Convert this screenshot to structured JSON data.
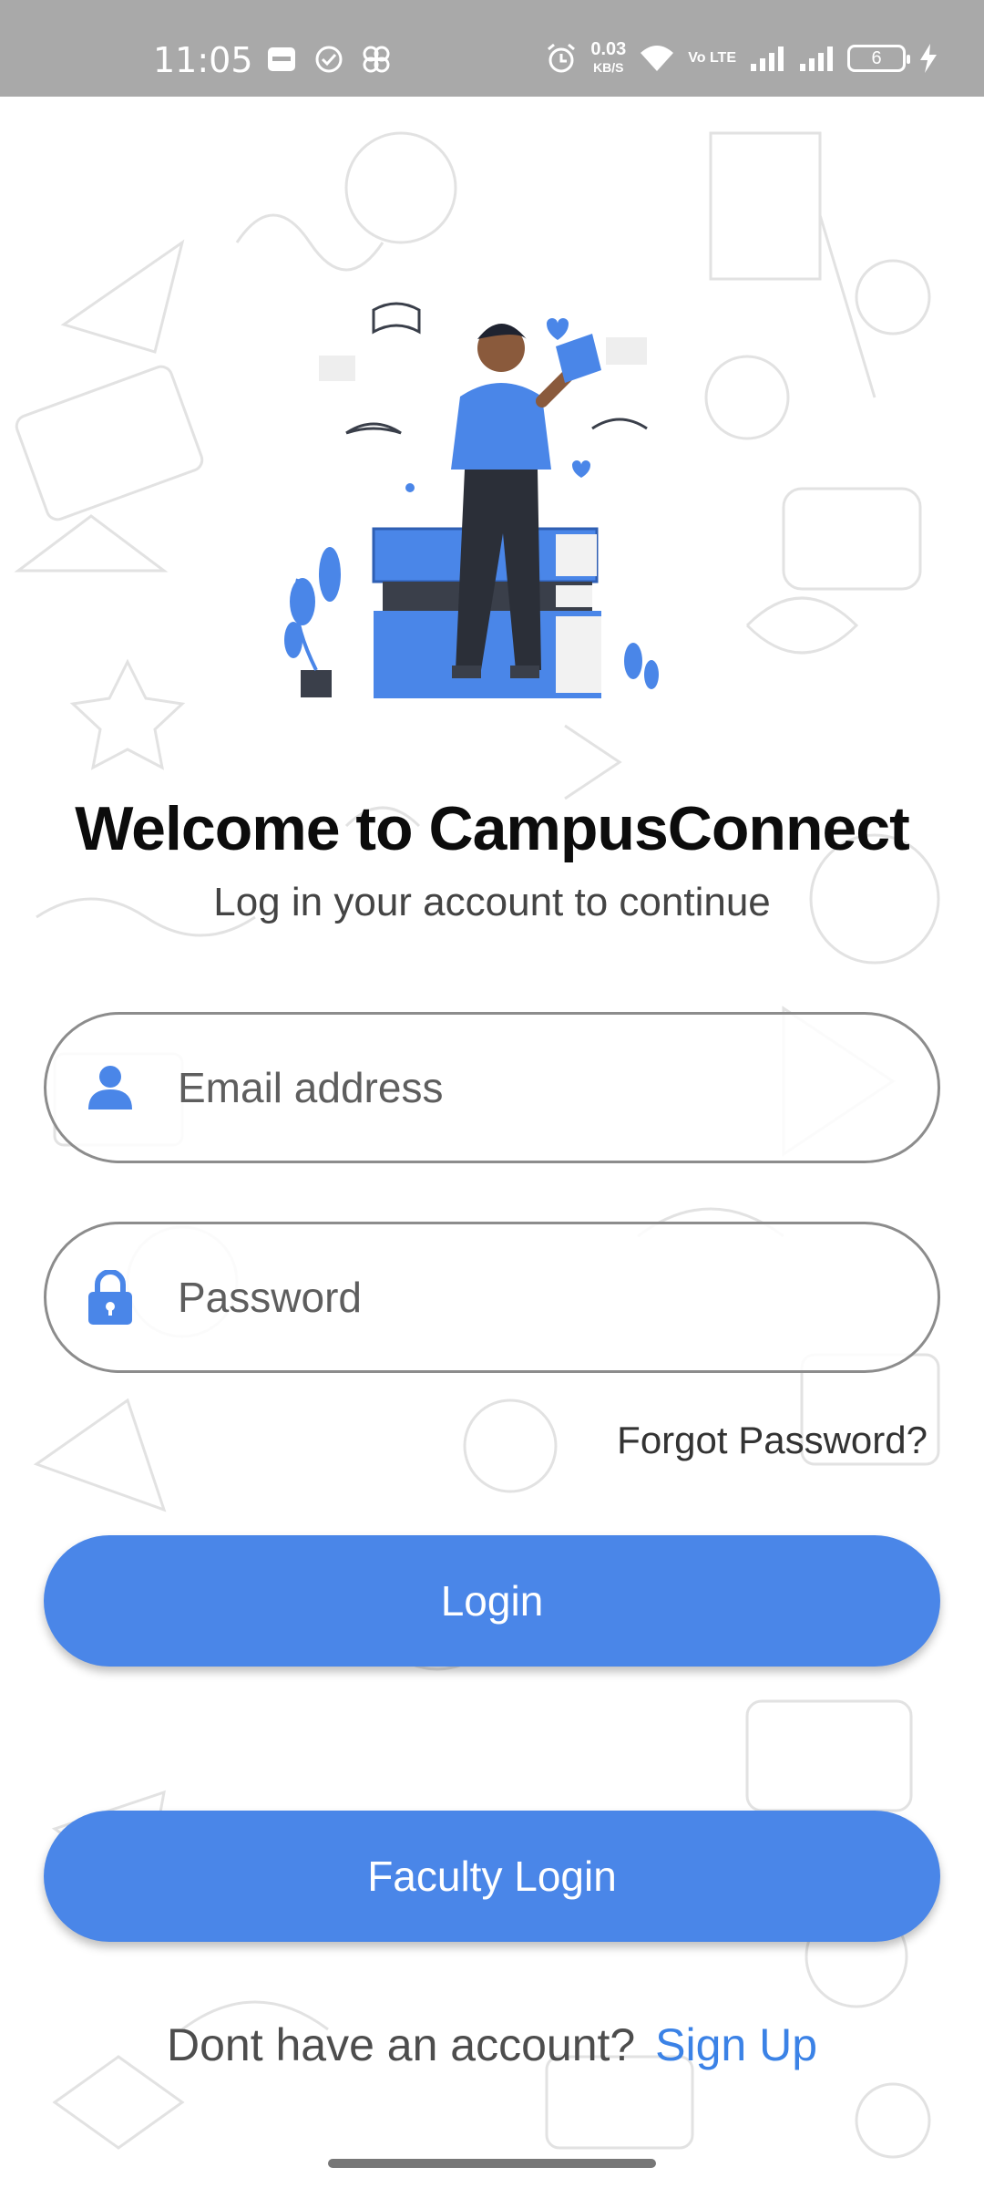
{
  "status_bar": {
    "time": "11:05",
    "net_speed_value": "0.03",
    "net_speed_unit": "KB/S",
    "volte": "Vo LTE",
    "battery_level": "6",
    "icons": [
      "paytm-icon",
      "check-circle-icon",
      "pinwheel-icon",
      "alarm-icon",
      "wifi-icon",
      "signal-icon",
      "signal-icon",
      "battery-icon",
      "charging-icon"
    ]
  },
  "header": {
    "title": "Welcome to CampusConnect",
    "subtitle": "Log in your account to continue"
  },
  "form": {
    "email_placeholder": "Email address",
    "password_placeholder": "Password",
    "forgot_password": "Forgot Password?"
  },
  "buttons": {
    "login": "Login",
    "faculty_login": "Faculty Login"
  },
  "footer": {
    "prompt": "Dont have an account?",
    "signup": "Sign Up"
  },
  "colors": {
    "accent": "#4a86e8",
    "status_bar": "#a9a9a9",
    "link": "#3b82e6"
  }
}
